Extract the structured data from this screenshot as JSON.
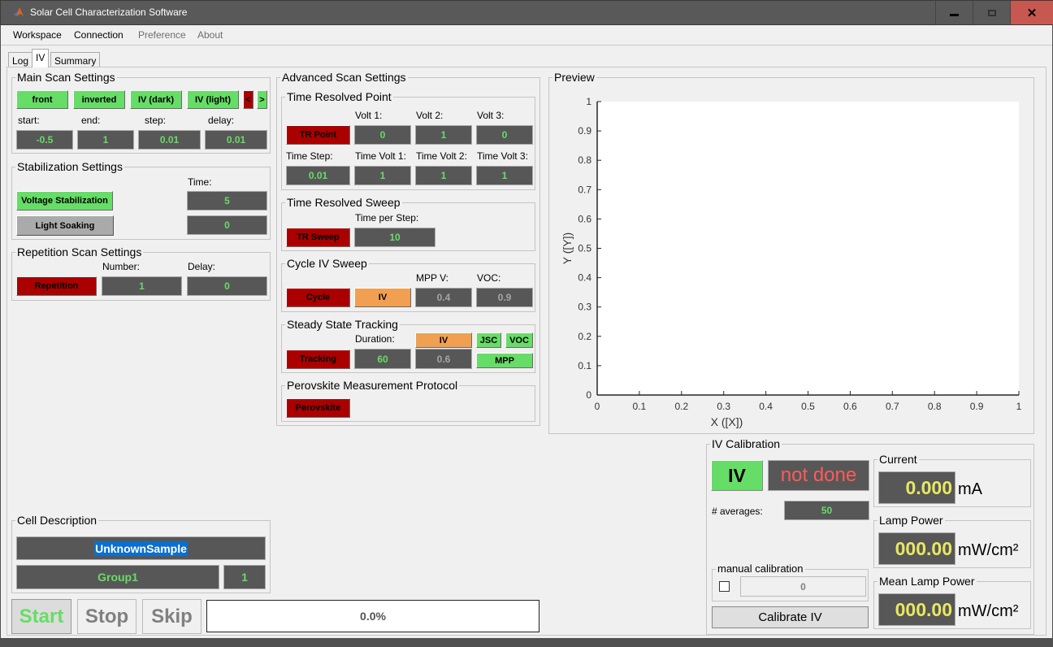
{
  "window": {
    "title": "Solar Cell Characterization Software",
    "controls": [
      "minimize",
      "maximize",
      "close"
    ]
  },
  "menu": [
    "Workspace",
    "Connection",
    "Preference",
    "About"
  ],
  "tabs": [
    "Log",
    "IV",
    "Summary"
  ],
  "active_tab": "IV",
  "main_scan": {
    "title": "Main Scan Settings",
    "toggles": [
      "front",
      "inverted",
      "IV (dark)",
      "IV (light)"
    ],
    "prev": "<",
    "next": ">",
    "labels": [
      "start:",
      "end:",
      "step:",
      "delay:"
    ],
    "values": [
      "-0.5",
      "1",
      "0.01",
      "0.01"
    ]
  },
  "stabilization": {
    "title": "Stabilization Settings",
    "time_label": "Time:",
    "voltage_btn": "Voltage Stabilization",
    "voltage_time": "5",
    "light_btn": "Light Soaking",
    "light_time": "0"
  },
  "repetition": {
    "title": "Repetition Scan Settings",
    "btn": "Repetition",
    "number_label": "Number:",
    "number": "1",
    "delay_label": "Delay:",
    "delay": "0"
  },
  "cell": {
    "title": "Cell Description",
    "name": "UnknownSample",
    "group": "Group1",
    "index": "1"
  },
  "controls": {
    "start": "Start",
    "stop": "Stop",
    "skip": "Skip",
    "progress": "0.0%",
    "progress_value": 0.0
  },
  "advanced": {
    "title": "Advanced Scan Settings",
    "trp": {
      "title": "Time Resolved Point",
      "btn": "TR Point",
      "volt_labels": [
        "Volt 1:",
        "Volt 2:",
        "Volt 3:"
      ],
      "volts": [
        "0",
        "1",
        "0"
      ],
      "step_label": "Time Step:",
      "step": "0.01",
      "time_labels": [
        "Time Volt 1:",
        "Time Volt 2:",
        "Time Volt 3:"
      ],
      "times": [
        "1",
        "1",
        "1"
      ]
    },
    "trs": {
      "title": "Time Resolved Sweep",
      "btn": "TR Sweep",
      "label": "Time per Step:",
      "value": "10"
    },
    "cycle": {
      "title": "Cycle IV Sweep",
      "btn": "Cycle",
      "iv": "IV",
      "mpp_label": "MPP V:",
      "mpp": "0.4",
      "voc_label": "VOC:",
      "voc": "0.9"
    },
    "sst": {
      "title": "Steady State Tracking",
      "btn": "Tracking",
      "dur_label": "Duration:",
      "dur": "60",
      "iv": "IV",
      "iv_val": "0.6",
      "jsc": "JSC",
      "voc": "VOC",
      "mpp": "MPP"
    },
    "pero": {
      "title": "Perovskite Measurement Protocol",
      "btn": "Perovskite"
    }
  },
  "preview": {
    "title": "Preview"
  },
  "chart_data": {
    "type": "line",
    "title": "",
    "xlabel": "X ([X])",
    "ylabel": "Y ([Y])",
    "xlim": [
      0,
      1
    ],
    "ylim": [
      0,
      1
    ],
    "xticks": [
      "0",
      "0.1",
      "0.2",
      "0.3",
      "0.4",
      "0.5",
      "0.6",
      "0.7",
      "0.8",
      "0.9",
      "1"
    ],
    "yticks": [
      "0",
      "0.1",
      "0.2",
      "0.3",
      "0.4",
      "0.5",
      "0.6",
      "0.7",
      "0.8",
      "0.9",
      "1"
    ],
    "series": [],
    "grid": false
  },
  "calibration": {
    "title": "IV Calibration",
    "iv_btn": "IV",
    "status": "not done",
    "avg_label": "# averages:",
    "avg": "50",
    "manual_title": "manual calibration",
    "manual_value": "0",
    "calibrate_btn": "Calibrate IV"
  },
  "readouts": {
    "current": {
      "title": "Current",
      "value": "0.000",
      "unit": "mA"
    },
    "lamp": {
      "title": "Lamp Power",
      "value": "000.00",
      "unit": "mW/cm²"
    },
    "mean_lamp": {
      "title": "Mean Lamp Power",
      "value": "000.00",
      "unit": "mW/cm²"
    }
  },
  "colors": {
    "on": "#66dd66",
    "off": "#aa0000",
    "orange": "#f0a050",
    "field": "#575757",
    "value_green": "#66dd66",
    "readout_yellow": "#e8e860",
    "status_red": "#ff5a5a"
  }
}
